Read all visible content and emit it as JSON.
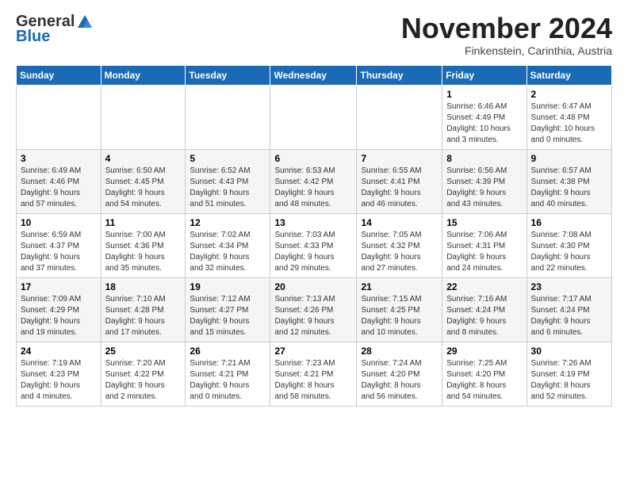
{
  "logo": {
    "general": "General",
    "blue": "Blue"
  },
  "title": "November 2024",
  "subtitle": "Finkenstein, Carinthia, Austria",
  "days_header": [
    "Sunday",
    "Monday",
    "Tuesday",
    "Wednesday",
    "Thursday",
    "Friday",
    "Saturday"
  ],
  "weeks": [
    [
      {
        "day": "",
        "info": ""
      },
      {
        "day": "",
        "info": ""
      },
      {
        "day": "",
        "info": ""
      },
      {
        "day": "",
        "info": ""
      },
      {
        "day": "",
        "info": ""
      },
      {
        "day": "1",
        "info": "Sunrise: 6:46 AM\nSunset: 4:49 PM\nDaylight: 10 hours\nand 3 minutes."
      },
      {
        "day": "2",
        "info": "Sunrise: 6:47 AM\nSunset: 4:48 PM\nDaylight: 10 hours\nand 0 minutes."
      }
    ],
    [
      {
        "day": "3",
        "info": "Sunrise: 6:49 AM\nSunset: 4:46 PM\nDaylight: 9 hours\nand 57 minutes."
      },
      {
        "day": "4",
        "info": "Sunrise: 6:50 AM\nSunset: 4:45 PM\nDaylight: 9 hours\nand 54 minutes."
      },
      {
        "day": "5",
        "info": "Sunrise: 6:52 AM\nSunset: 4:43 PM\nDaylight: 9 hours\nand 51 minutes."
      },
      {
        "day": "6",
        "info": "Sunrise: 6:53 AM\nSunset: 4:42 PM\nDaylight: 9 hours\nand 48 minutes."
      },
      {
        "day": "7",
        "info": "Sunrise: 6:55 AM\nSunset: 4:41 PM\nDaylight: 9 hours\nand 46 minutes."
      },
      {
        "day": "8",
        "info": "Sunrise: 6:56 AM\nSunset: 4:39 PM\nDaylight: 9 hours\nand 43 minutes."
      },
      {
        "day": "9",
        "info": "Sunrise: 6:57 AM\nSunset: 4:38 PM\nDaylight: 9 hours\nand 40 minutes."
      }
    ],
    [
      {
        "day": "10",
        "info": "Sunrise: 6:59 AM\nSunset: 4:37 PM\nDaylight: 9 hours\nand 37 minutes."
      },
      {
        "day": "11",
        "info": "Sunrise: 7:00 AM\nSunset: 4:36 PM\nDaylight: 9 hours\nand 35 minutes."
      },
      {
        "day": "12",
        "info": "Sunrise: 7:02 AM\nSunset: 4:34 PM\nDaylight: 9 hours\nand 32 minutes."
      },
      {
        "day": "13",
        "info": "Sunrise: 7:03 AM\nSunset: 4:33 PM\nDaylight: 9 hours\nand 29 minutes."
      },
      {
        "day": "14",
        "info": "Sunrise: 7:05 AM\nSunset: 4:32 PM\nDaylight: 9 hours\nand 27 minutes."
      },
      {
        "day": "15",
        "info": "Sunrise: 7:06 AM\nSunset: 4:31 PM\nDaylight: 9 hours\nand 24 minutes."
      },
      {
        "day": "16",
        "info": "Sunrise: 7:08 AM\nSunset: 4:30 PM\nDaylight: 9 hours\nand 22 minutes."
      }
    ],
    [
      {
        "day": "17",
        "info": "Sunrise: 7:09 AM\nSunset: 4:29 PM\nDaylight: 9 hours\nand 19 minutes."
      },
      {
        "day": "18",
        "info": "Sunrise: 7:10 AM\nSunset: 4:28 PM\nDaylight: 9 hours\nand 17 minutes."
      },
      {
        "day": "19",
        "info": "Sunrise: 7:12 AM\nSunset: 4:27 PM\nDaylight: 9 hours\nand 15 minutes."
      },
      {
        "day": "20",
        "info": "Sunrise: 7:13 AM\nSunset: 4:26 PM\nDaylight: 9 hours\nand 12 minutes."
      },
      {
        "day": "21",
        "info": "Sunrise: 7:15 AM\nSunset: 4:25 PM\nDaylight: 9 hours\nand 10 minutes."
      },
      {
        "day": "22",
        "info": "Sunrise: 7:16 AM\nSunset: 4:24 PM\nDaylight: 9 hours\nand 8 minutes."
      },
      {
        "day": "23",
        "info": "Sunrise: 7:17 AM\nSunset: 4:24 PM\nDaylight: 9 hours\nand 6 minutes."
      }
    ],
    [
      {
        "day": "24",
        "info": "Sunrise: 7:19 AM\nSunset: 4:23 PM\nDaylight: 9 hours\nand 4 minutes."
      },
      {
        "day": "25",
        "info": "Sunrise: 7:20 AM\nSunset: 4:22 PM\nDaylight: 9 hours\nand 2 minutes."
      },
      {
        "day": "26",
        "info": "Sunrise: 7:21 AM\nSunset: 4:21 PM\nDaylight: 9 hours\nand 0 minutes."
      },
      {
        "day": "27",
        "info": "Sunrise: 7:23 AM\nSunset: 4:21 PM\nDaylight: 8 hours\nand 58 minutes."
      },
      {
        "day": "28",
        "info": "Sunrise: 7:24 AM\nSunset: 4:20 PM\nDaylight: 8 hours\nand 56 minutes."
      },
      {
        "day": "29",
        "info": "Sunrise: 7:25 AM\nSunset: 4:20 PM\nDaylight: 8 hours\nand 54 minutes."
      },
      {
        "day": "30",
        "info": "Sunrise: 7:26 AM\nSunset: 4:19 PM\nDaylight: 8 hours\nand 52 minutes."
      }
    ]
  ]
}
